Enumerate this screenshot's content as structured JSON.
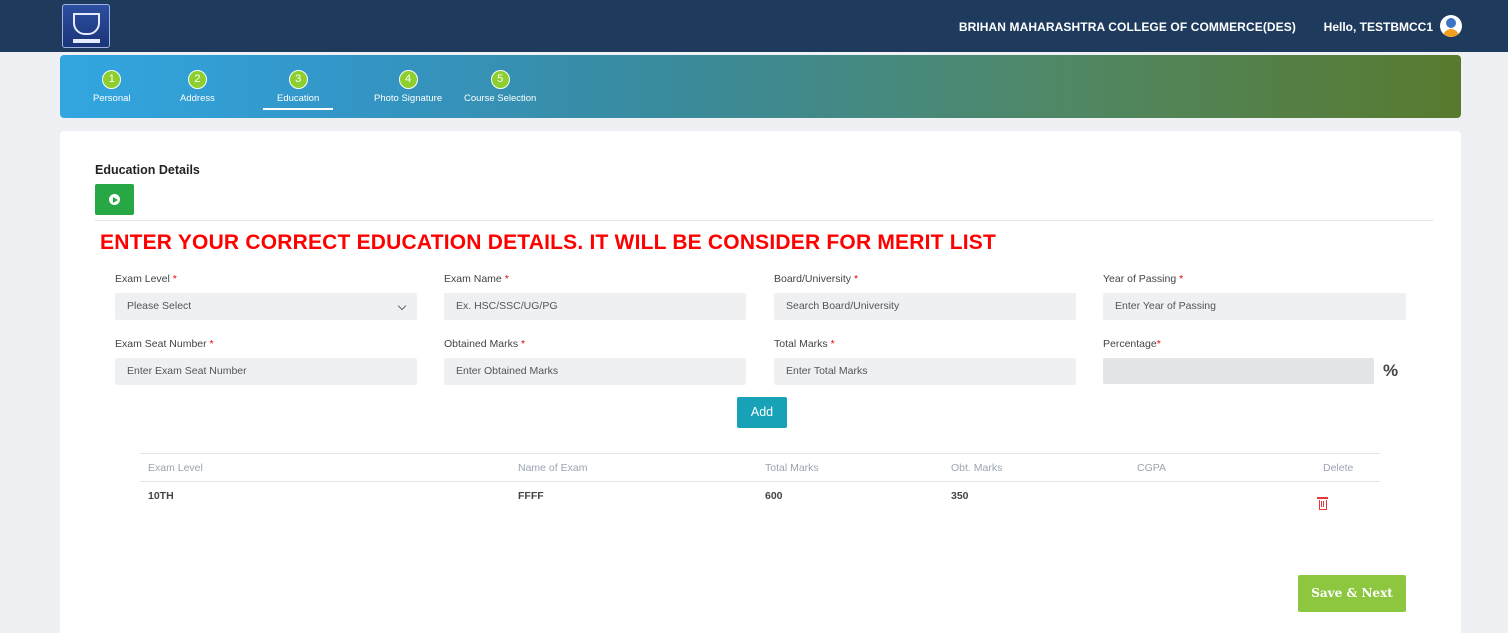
{
  "header": {
    "college_name": "BRIHAN MAHARASHTRA COLLEGE OF COMMERCE(DES)",
    "greeting": "Hello, TESTBMCC1"
  },
  "stepper": {
    "steps": [
      {
        "num": "1",
        "label": "Personal"
      },
      {
        "num": "2",
        "label": "Address"
      },
      {
        "num": "3",
        "label": "Education"
      },
      {
        "num": "4",
        "label": "Photo Signature"
      },
      {
        "num": "5",
        "label": "Course Selection"
      }
    ],
    "active_step": "Education"
  },
  "card": {
    "title": "Education Details",
    "notice": "ENTER YOUR CORRECT EDUCATION DETAILS.  IT WILL BE CONSIDER FOR MERIT LIST"
  },
  "form": {
    "exam_level": {
      "label": "Exam Level",
      "placeholder": "Please Select"
    },
    "exam_name": {
      "label": "Exam Name",
      "placeholder": "Ex. HSC/SSC/UG/PG"
    },
    "board": {
      "label": "Board/University",
      "placeholder": "Search Board/University"
    },
    "year": {
      "label": "Year of Passing",
      "placeholder": "Enter Year of Passing"
    },
    "seat": {
      "label": "Exam Seat Number",
      "placeholder": "Enter Exam Seat Number"
    },
    "obtained": {
      "label": "Obtained Marks",
      "placeholder": "Enter Obtained Marks"
    },
    "total": {
      "label": "Total Marks",
      "placeholder": "Enter Total Marks"
    },
    "percentage": {
      "label": "Percentage",
      "suffix": "%"
    },
    "required_mark": "*",
    "add_label": "Add"
  },
  "table": {
    "headers": [
      "Exam Level",
      "Name of Exam",
      "Total Marks",
      "Obt. Marks",
      "CGPA",
      "Delete"
    ],
    "rows": [
      {
        "exam_level": "10TH",
        "exam_name": "FFFF",
        "total": "600",
        "obtained": "350",
        "cgpa": ""
      }
    ]
  },
  "save_label": "Save & Next",
  "colors": {
    "header_bg": "#1e3a5c",
    "notice": "#ff0000",
    "add_button": "#17a2b8",
    "save_button": "#8dc63f",
    "play_button": "#28a745",
    "delete_icon": "#e53935"
  }
}
